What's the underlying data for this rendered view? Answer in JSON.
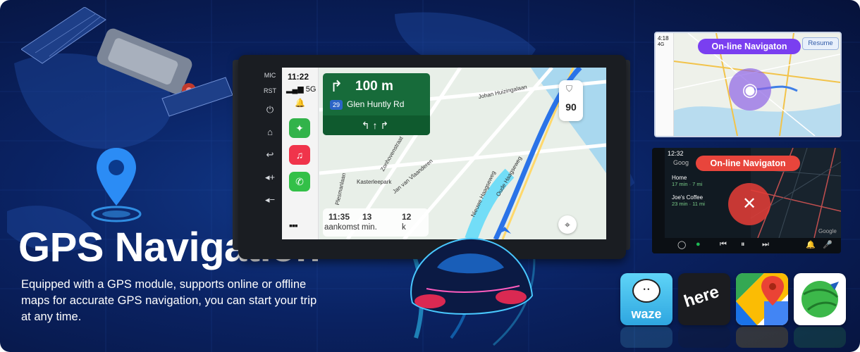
{
  "headline": "GPS Navigation",
  "description": "Equipped with a GPS module, supports online or offline maps for accurate GPS navigation, you can start your trip at any time.",
  "head_unit": {
    "side_buttons": [
      "MIC",
      "RST"
    ],
    "status": {
      "time": "11:22",
      "signal": "5G"
    },
    "turn": {
      "distance": "100 m",
      "route_badge": "29",
      "road": "Glen Huntly Rd"
    },
    "speed_limit": "90",
    "eta": {
      "t1": "11:35",
      "t2": "13",
      "t3": "12",
      "label1": "aankomst min.",
      "label2": "k"
    },
    "map_labels": [
      "Johan Huizingalaan",
      "Kasterleepark",
      "Plesmanlaan",
      "Zonhovenstraat",
      "Jan van Vlaanderen",
      "Oude Haagseweg",
      "Nieuwe Haagseweg"
    ]
  },
  "panel_online": {
    "time": "4:18",
    "signal": "4G",
    "label": "On-line Navigaton",
    "resume_label": "Resume"
  },
  "panel_offline": {
    "time": "12:32",
    "label": "On-line Navigaton",
    "search": "Goog",
    "items": [
      {
        "title": "Home",
        "sub": "17 min · 7 mi"
      },
      {
        "title": "Joe's Coffee",
        "sub": "23 min · 11 mi"
      }
    ],
    "watermark": "Google"
  },
  "apps": [
    {
      "name": "waze",
      "label": "waze"
    },
    {
      "name": "here",
      "label": "here"
    },
    {
      "name": "google-maps",
      "label": "G"
    },
    {
      "name": "navitel",
      "label": ""
    }
  ],
  "colors": {
    "background": "#0a2262",
    "nav_green": "#176b3a",
    "online_pill": "#7a3ff0",
    "offline_pill": "#e8453c"
  }
}
